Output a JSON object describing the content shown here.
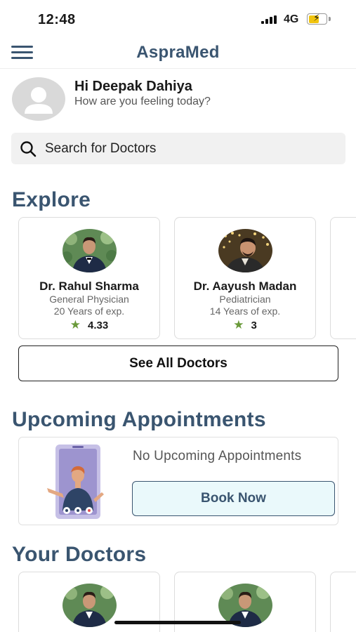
{
  "status_bar": {
    "time": "12:48",
    "network": "4G",
    "battery_color": "#f1c40f"
  },
  "header": {
    "title": "AspraMed",
    "menu_icon": "hamburger-menu-icon"
  },
  "greeting": {
    "name": "Hi Deepak Dahiya",
    "subtitle": "How are you feeling today?"
  },
  "search": {
    "placeholder": "Search for Doctors",
    "icon": "search-icon"
  },
  "explore": {
    "title": "Explore",
    "doctors": [
      {
        "name": "Dr. Rahul Sharma",
        "specialty": "General Physician",
        "experience": "20 Years of exp.",
        "rating": "4.33"
      },
      {
        "name": "Dr. Aayush Madan",
        "specialty": "Pediatrician",
        "experience": "14 Years of exp.",
        "rating": "3"
      }
    ],
    "see_all_label": "See All Doctors"
  },
  "appointments": {
    "title": "Upcoming Appointments",
    "empty_text": "No Upcoming Appointments",
    "book_now_label": "Book Now"
  },
  "your_doctors": {
    "title": "Your Doctors"
  },
  "colors": {
    "primary": "#3a5570",
    "star": "#6a9a3a",
    "book_button_bg": "#eaf9fb"
  }
}
